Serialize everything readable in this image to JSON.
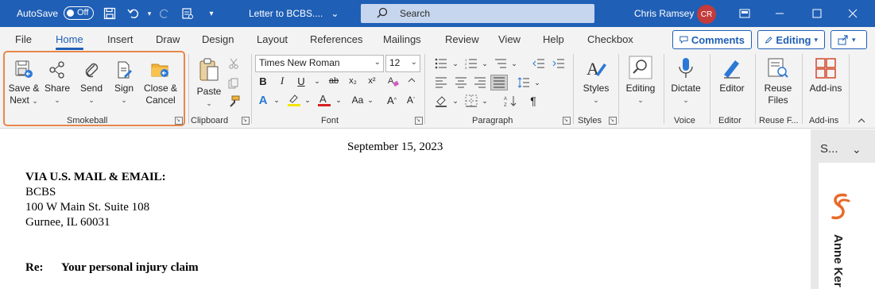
{
  "titlebar": {
    "autosave_label": "AutoSave",
    "autosave_state": "Off",
    "document_title": "Letter to BCBS....",
    "search_label": "Search",
    "user_name": "Chris Ramsey",
    "user_initials": "CR"
  },
  "tabs": [
    "File",
    "Home",
    "Insert",
    "Draw",
    "Design",
    "Layout",
    "References",
    "Mailings",
    "Review",
    "View",
    "Help",
    "Checkbox"
  ],
  "active_tab": "Home",
  "actions": {
    "comments_label": "Comments",
    "editing_label": "Editing"
  },
  "ribbon": {
    "smokeball": {
      "group_label": "Smokeball",
      "buttons": [
        {
          "line1": "Save &",
          "line2": "Next"
        },
        {
          "line1": "Share",
          "line2": ""
        },
        {
          "line1": "Send",
          "line2": ""
        },
        {
          "line1": "Sign",
          "line2": ""
        },
        {
          "line1": "Close &",
          "line2": "Cancel"
        }
      ]
    },
    "clipboard": {
      "group_label": "Clipboard",
      "paste_label": "Paste"
    },
    "font": {
      "group_label": "Font",
      "font_name": "Times New Roman",
      "font_size": "12"
    },
    "paragraph": {
      "group_label": "Paragraph"
    },
    "styles": {
      "group_label": "Styles",
      "styles_label": "Styles"
    },
    "editing": {
      "editing_label": "Editing"
    },
    "voice": {
      "group_label": "Voice",
      "dictate_label": "Dictate"
    },
    "editor": {
      "group_label": "Editor",
      "editor_label": "Editor"
    },
    "reuse": {
      "group_label": "Reuse F...",
      "line1": "Reuse",
      "line2": "Files"
    },
    "addins": {
      "group_label": "Add-ins",
      "label": "Add-ins"
    }
  },
  "document": {
    "date": "September 15, 2023",
    "via": "VIA U.S. MAIL & EMAIL:",
    "recipient": "BCBS",
    "address1": "100 W Main St. Suite 108",
    "address2": "Gurnee, IL 60031",
    "re_label": "Re:",
    "re_text": "Your personal injury claim"
  },
  "side_pane": {
    "title": "S...",
    "contact_name": "Anne Ker"
  },
  "colors": {
    "title_bar": "#1f5fb6",
    "smokeball_highlight": "#e8874a",
    "smokeball_logo": "#e8692a"
  }
}
